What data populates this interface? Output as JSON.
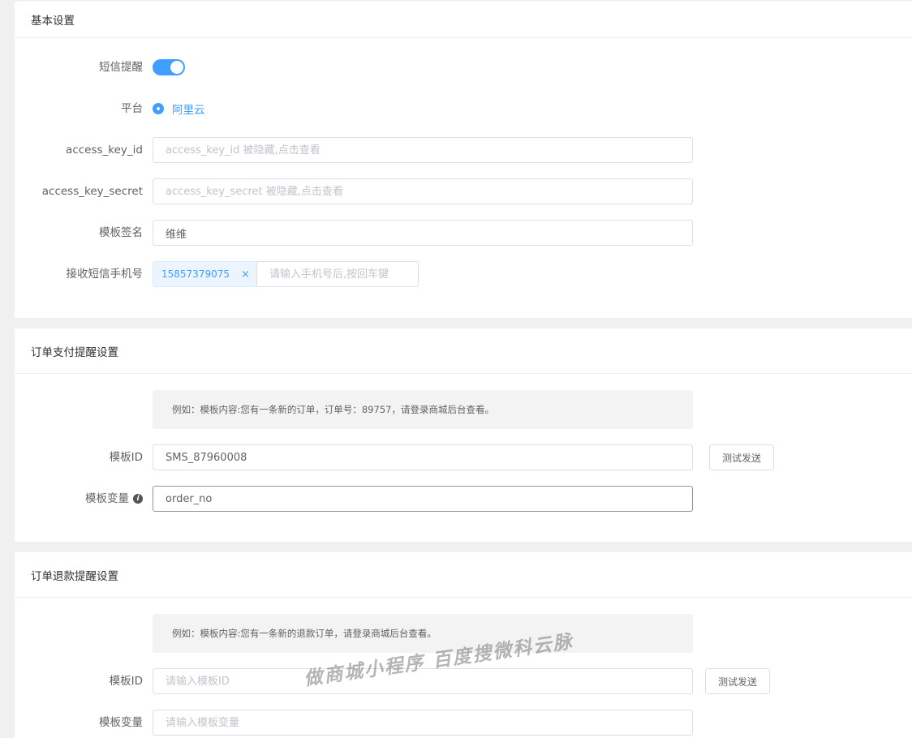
{
  "basic": {
    "title": "基本设置",
    "sms_label": "短信提醒",
    "sms_enabled": true,
    "platform_label": "平台",
    "platform_option": "阿里云",
    "access_key_id_label": "access_key_id",
    "access_key_id_placeholder": "access_key_id 被隐藏,点击查看",
    "access_key_secret_label": "access_key_secret",
    "access_key_secret_placeholder": "access_key_secret 被隐藏,点击查看",
    "sign_label": "模板签名",
    "sign_value": "维维",
    "phone_label": "接收短信手机号",
    "phone_tag": "15857379075",
    "phone_tag_close": "×",
    "phone_placeholder": "请输入手机号后,按回车键"
  },
  "order_pay": {
    "title": "订单支付提醒设置",
    "hint": "例如：模板内容:您有一条新的订单，订单号：89757，请登录商城后台查看。",
    "template_id_label": "模板ID",
    "template_id_value": "SMS_87960008",
    "test_button": "测试发送",
    "variable_label": "模板变量",
    "variable_icon": "info-icon",
    "variable_value": "order_no"
  },
  "order_refund": {
    "title": "订单退款提醒设置",
    "hint": "例如：模板内容:您有一条新的退款订单，请登录商城后台查看。",
    "template_id_label": "模板ID",
    "template_id_placeholder": "请输入模板ID",
    "test_button": "测试发送",
    "variable_label": "模板变量",
    "variable_placeholder": "请输入模板变量"
  },
  "watermark": "做商城小程序 百度搜微科云脉",
  "colors": {
    "accent": "#409eff",
    "background": "#f0f0f0"
  }
}
